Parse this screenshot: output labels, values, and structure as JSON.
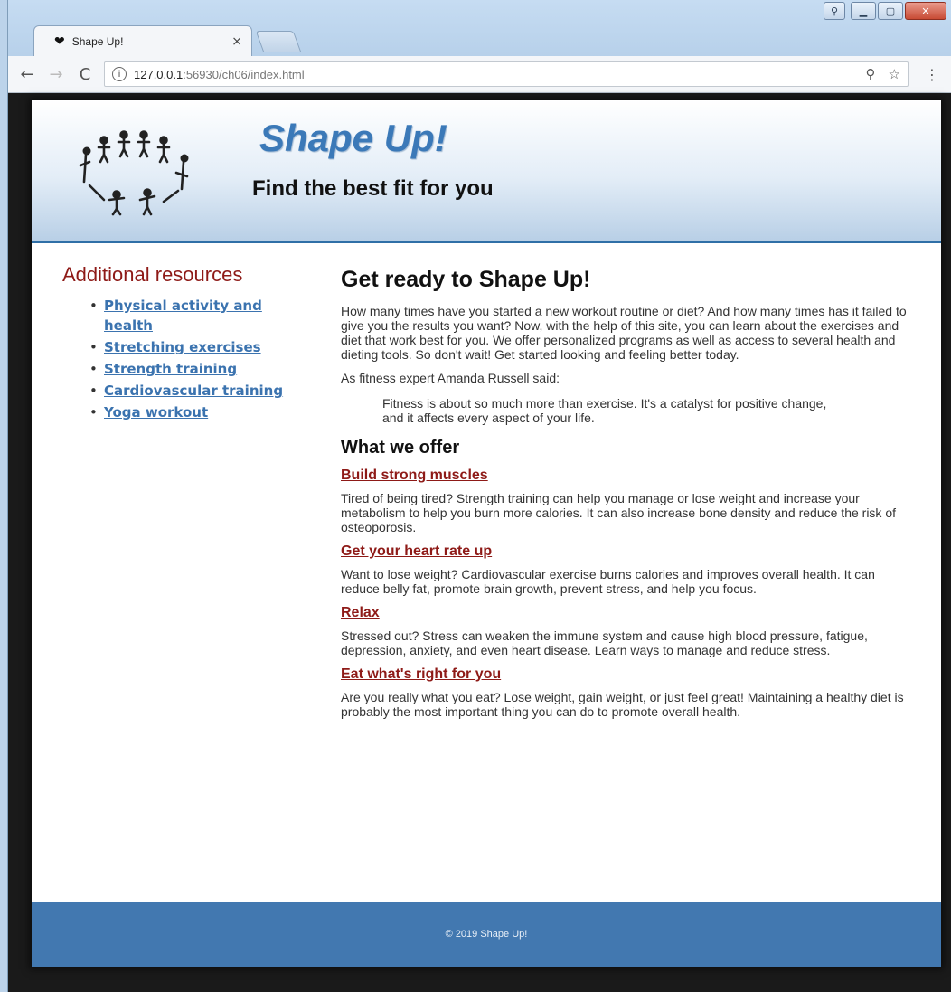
{
  "browser": {
    "tab_title": "Shape Up!",
    "tab_icon": "heart-icon",
    "tab_close": "×",
    "url_host": "127.0.0.1",
    "url_path": ":56930/ch06/index.html",
    "nav": {
      "back": "←",
      "forward": "→",
      "reload": "C"
    }
  },
  "header": {
    "title": "Shape Up!",
    "tagline": "Find the best fit for you",
    "logo_icon": "people-circle-icon"
  },
  "sidebar": {
    "heading": "Additional resources",
    "links": [
      {
        "label": "Physical activity and health"
      },
      {
        "label": "Stretching exercises"
      },
      {
        "label": "Strength training"
      },
      {
        "label": "Cardiovascular training"
      },
      {
        "label": "Yoga workout"
      }
    ]
  },
  "main": {
    "heading": "Get ready to Shape Up!",
    "intro": "How many times have you started a new workout routine or diet? And how many times has it failed to give you the results you want? Now, with the help of this site, you can learn about the exercises and diet that work best for you. We offer personalized programs as well as access to several health and dieting tools. So don't wait! Get started looking and feeling better today.",
    "quote_intro": "As fitness expert Amanda Russell said:",
    "quote": "Fitness is about so much more than exercise. It's a catalyst for positive change, and it affects every aspect of your life.",
    "offer_heading": "What we offer",
    "sections": [
      {
        "title": "Build strong muscles",
        "text": "Tired of being tired? Strength training can help you manage or lose weight and increase your metabolism to help you burn more calories. It can also increase bone density and reduce the risk of osteoporosis."
      },
      {
        "title": "Get your heart rate up",
        "text": "Want to lose weight? Cardiovascular exercise burns calories and improves overall health. It can reduce belly fat, promote brain growth, prevent stress, and help you focus."
      },
      {
        "title": "Relax",
        "text": "Stressed out? Stress can weaken the immune system and cause high blood pressure, fatigue, depression, anxiety, and even heart disease. Learn ways to manage and reduce stress."
      },
      {
        "title": "Eat what's right for you",
        "text": "Are you really what you eat? Lose weight, gain weight, or just feel great! Maintaining a healthy diet is probably the most important thing you can do to promote overall health."
      }
    ]
  },
  "footer": {
    "text": "© 2019 Shape Up!"
  },
  "colors": {
    "brand_blue": "#3b79b8",
    "accent_red": "#8e1a17",
    "footer_blue": "#4278b0",
    "link_blue": "#3b73af"
  }
}
